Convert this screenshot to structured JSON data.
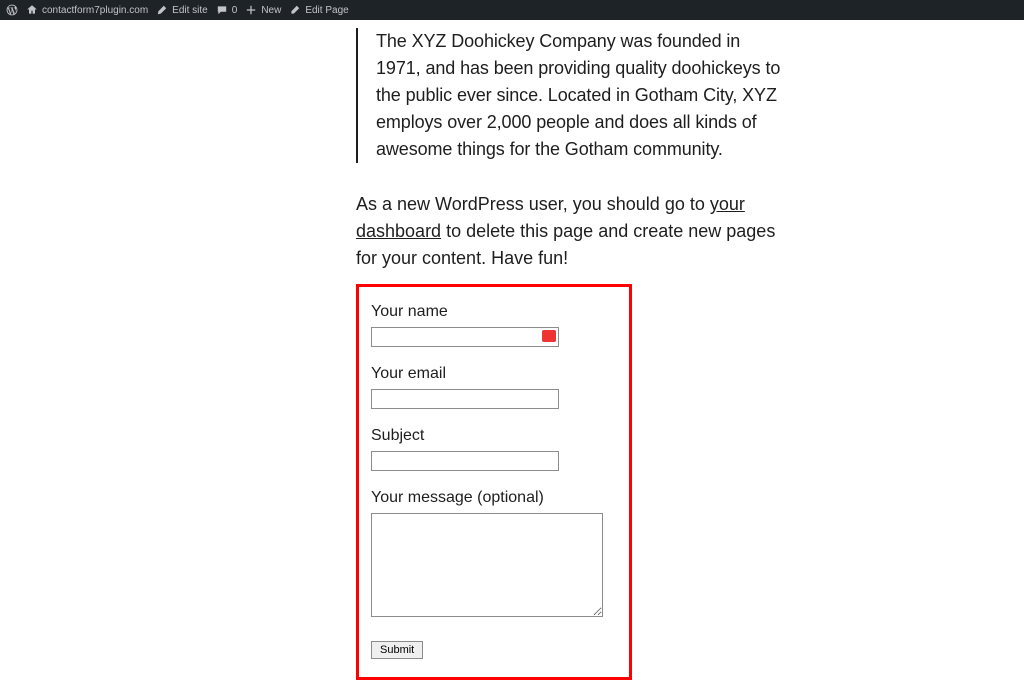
{
  "admin_bar": {
    "site_name": "contactform7plugin.com",
    "edit_site": "Edit site",
    "comments_count": "0",
    "new_label": "New",
    "edit_page": "Edit Page"
  },
  "content": {
    "blockquote": "The XYZ Doohickey Company was founded in 1971, and has been providing quality doohickeys to the public ever since. Located in Gotham City, XYZ employs over 2,000 people and does all kinds of awesome things for the Gotham community.",
    "paragraph_pre": "As a new WordPress user, you should go to ",
    "dashboard_link": "your dashboard",
    "paragraph_post": " to delete this page and create new pages for your content. Have fun!"
  },
  "form": {
    "name_label": "Your name",
    "email_label": "Your email",
    "subject_label": "Subject",
    "message_label": "Your message (optional)",
    "submit_label": "Submit"
  }
}
